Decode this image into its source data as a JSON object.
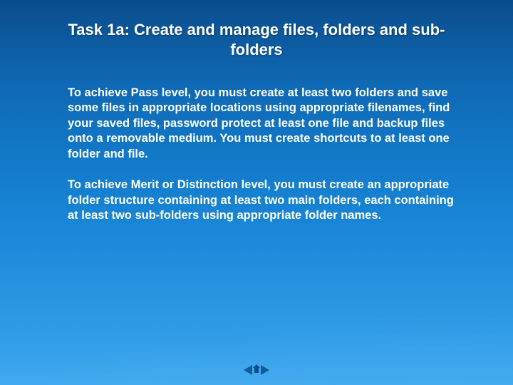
{
  "slide": {
    "title": "Task 1a: Create and manage files, folders and sub-folders",
    "paragraphs": [
      "To achieve Pass level, you must create at least two folders and save some files in appropriate locations using appropriate filenames, find your saved files, password protect at least one file and backup files onto a removable medium. You must create shortcuts to at least one folder and file.",
      "To achieve Merit or Distinction level, you must create an appropriate folder structure containing at least two main folders, each containing at least two sub-folders using appropriate folder names."
    ],
    "nav": {
      "prev": "Previous slide",
      "home": "First slide",
      "next": "Next slide"
    },
    "colors": {
      "bg_top": "#0a4d8c",
      "bg_bottom": "#3aa6ee",
      "text": "#ffffff",
      "nav_icon": "#0a4d8c"
    }
  }
}
